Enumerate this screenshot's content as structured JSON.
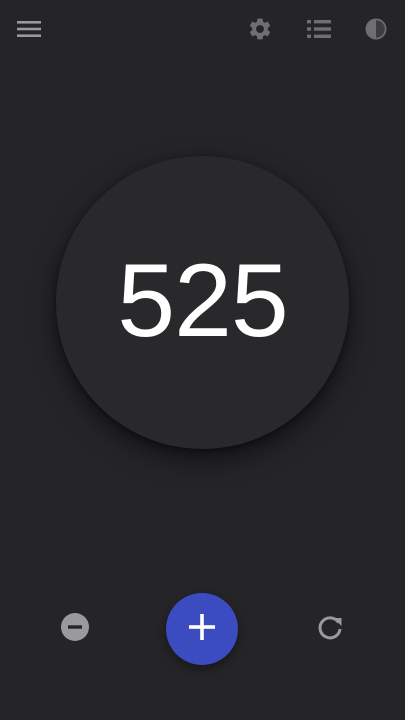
{
  "app": {
    "counter_value": "525"
  },
  "toolbar": {
    "icons": [
      "menu-icon",
      "settings-gear-icon",
      "list-icon",
      "contrast-icon"
    ]
  },
  "controls": {
    "icons": [
      "minus-icon",
      "plus-icon",
      "reset-icon"
    ]
  },
  "colors": {
    "background": "#252427",
    "circle": "#29282b",
    "accent": "#3b4bc0",
    "icon_gray": "#9a9a9e",
    "text": "#ffffff"
  }
}
